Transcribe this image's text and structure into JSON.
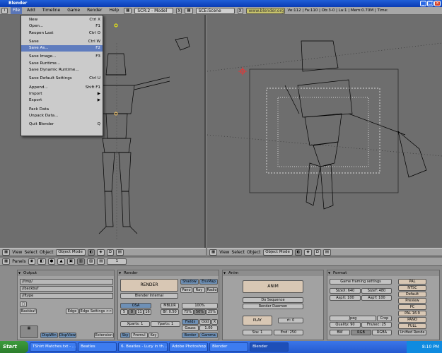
{
  "window": {
    "title": "Blender"
  },
  "topbar": {
    "menus": [
      "File",
      "Add",
      "Timeline",
      "Game",
      "Render",
      "Help"
    ],
    "screen_field": "SCR:2 - Model",
    "scene_field": "SCE:Scene",
    "url": "www.blender.org 234",
    "stats": "Ve:112 | Fa:110 | Ob:3-0 | La:1 | Mem:0.70M | Time:"
  },
  "file_menu": {
    "items": [
      {
        "label": "New",
        "shortcut": "Ctrl X"
      },
      {
        "label": "Open...",
        "shortcut": "F1"
      },
      {
        "label": "Reopen Last",
        "shortcut": "Ctrl O"
      },
      {
        "label": "Save",
        "shortcut": "Ctrl W"
      },
      {
        "label": "Save As...",
        "shortcut": "F2"
      },
      {
        "label": "Save Image...",
        "shortcut": "F3"
      },
      {
        "label": "Save Runtime...",
        "shortcut": ""
      },
      {
        "label": "Save Dynamic Runtime...",
        "shortcut": ""
      },
      {
        "label": "Save Default Settings",
        "shortcut": "Ctrl U"
      },
      {
        "label": "Append...",
        "shortcut": "Shift F1"
      },
      {
        "label": "Import",
        "shortcut": "▶"
      },
      {
        "label": "Export",
        "shortcut": "▶"
      },
      {
        "label": "Pack Data",
        "shortcut": ""
      },
      {
        "label": "Unpack Data...",
        "shortcut": ""
      },
      {
        "label": "Quit Blender",
        "shortcut": "Q"
      }
    ]
  },
  "viewport_header": {
    "view": "View",
    "select": "Select",
    "object": "Object",
    "mode": "Object Mode"
  },
  "panels_bar": {
    "label": "Panels",
    "frame": "1"
  },
  "output_panel": {
    "title": "Output",
    "paths": [
      "//tmp/",
      "//backbuf",
      "//ftype"
    ],
    "backbuf": "Backbuf",
    "edge": "Edge",
    "edge_settings": "Edge Settings >>",
    "dispwin": "DispWin",
    "dispview": "DispView",
    "extensions": "Extension"
  },
  "render_panel": {
    "title": "Render",
    "render": "RENDER",
    "engine": "Blender Internal",
    "shadow": "Shadow",
    "envmap": "EnvMap",
    "pano": "Pano",
    "ray": "Ray",
    "radio": "Radio",
    "osa": "OSA",
    "osa_vals": [
      "5",
      "8",
      "11",
      "16"
    ],
    "mblur": "MBLUR",
    "bf": "Bf: 0.50",
    "pct": "100%",
    "pct_vals": [
      "75%",
      "50%",
      "25%"
    ],
    "xparts": "Xparts: 1",
    "yparts": "Yparts: 1",
    "fields": "Fields",
    "odd": "Odd",
    "x": "X",
    "gauss": "Gauss",
    "gauss_val": "1.00",
    "sky": "Sky",
    "premul": "Premul",
    "key": "Key",
    "border": "Border",
    "gamma": "Gamma"
  },
  "anim_panel": {
    "title": "Anim",
    "anim": "ANIM",
    "do_sequence": "Do Sequence",
    "render_daemon": "Render Daemon",
    "play": "PLAY",
    "rt": "rt: 0",
    "sta": "Sta: 1",
    "end": "End: 250"
  },
  "format_panel": {
    "title": "Format",
    "game_framing": "Game framing settings",
    "sizex": "SizeX: 640",
    "sizey": "SizeY: 480",
    "aspx": "AspX: 100",
    "aspy": "AspY: 100",
    "presets": [
      "PAL",
      "NTSC",
      "Default",
      "Preview",
      "PC",
      "PAL 16:9",
      "PANO",
      "FULL",
      "Unified Rende"
    ],
    "jpeg": "Jpeg",
    "crop": "Crop",
    "quality": "Quality: 90",
    "frs": "Frs/sec: 25",
    "bw": "BW",
    "rgb": "RGB",
    "rgba": "RGBA"
  },
  "taskbar": {
    "start": "Start",
    "tasks": [
      "TShirt Matches.txt - ...",
      "Beatles",
      "6. Beatles - Lucy in th...",
      "Adobe Photoshop",
      "Blender",
      "Blender"
    ],
    "clock": "8:10 PM"
  }
}
